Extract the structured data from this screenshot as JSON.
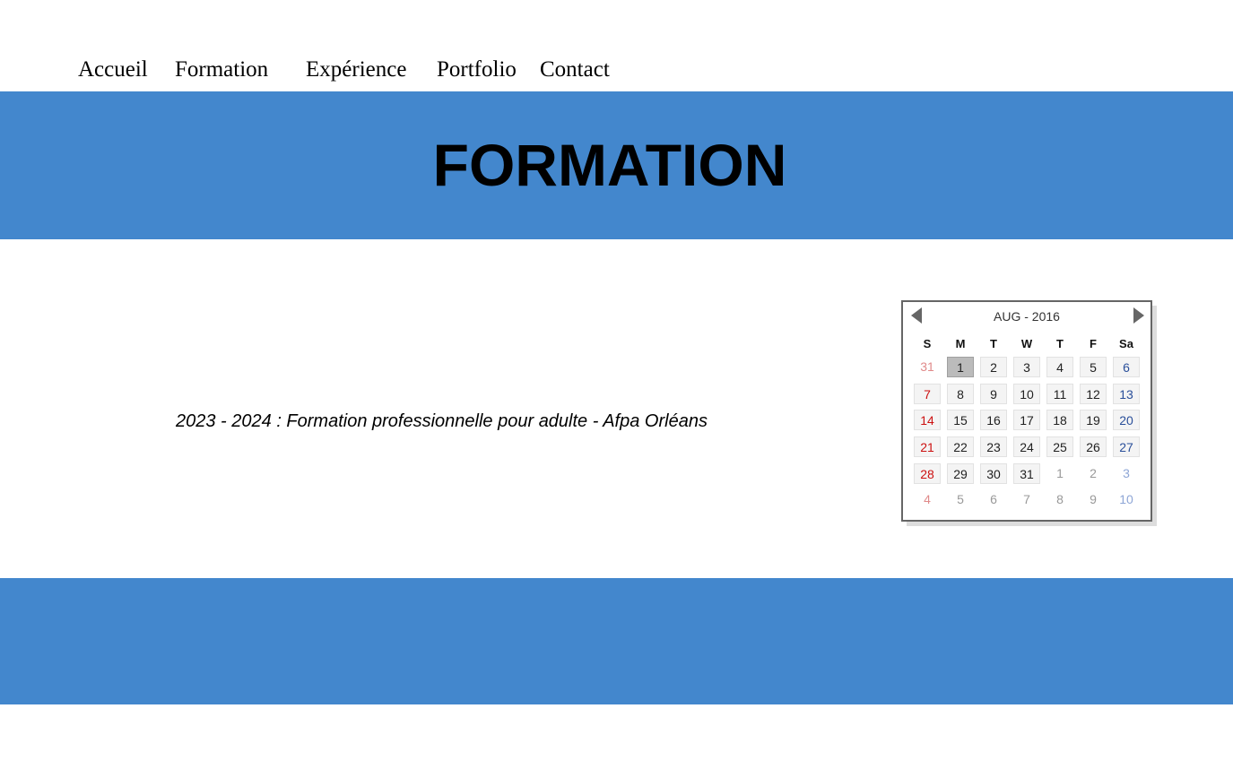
{
  "nav": {
    "items": [
      "Accueil",
      "Formation",
      "Expérience",
      "Portfolio",
      "Contact"
    ]
  },
  "hero": {
    "title": "FORMATION"
  },
  "content": {
    "formation_line": "2023 - 2024 : Formation professionnelle pour adulte - Afpa Orléans"
  },
  "calendar": {
    "month_label": "AUG - 2016",
    "prev_icon": "triangle-left-icon",
    "next_icon": "triangle-right-icon",
    "weekdays": [
      "S",
      "M",
      "T",
      "W",
      "T",
      "F",
      "Sa"
    ],
    "weeks": [
      [
        "31",
        "1",
        "2",
        "3",
        "4",
        "5",
        "6"
      ],
      [
        "7",
        "8",
        "9",
        "10",
        "11",
        "12",
        "13"
      ],
      [
        "14",
        "15",
        "16",
        "17",
        "18",
        "19",
        "20"
      ],
      [
        "21",
        "22",
        "23",
        "24",
        "25",
        "26",
        "27"
      ],
      [
        "28",
        "29",
        "30",
        "31",
        "1",
        "2",
        "3"
      ],
      [
        "4",
        "5",
        "6",
        "7",
        "8",
        "9",
        "10"
      ]
    ],
    "selected_day": "1",
    "colors": {
      "sunday": "#cc1111",
      "saturday": "#2a4f9a",
      "selected_bg": "#bbbbbb"
    }
  },
  "theme": {
    "band_color": "#4387cd"
  }
}
